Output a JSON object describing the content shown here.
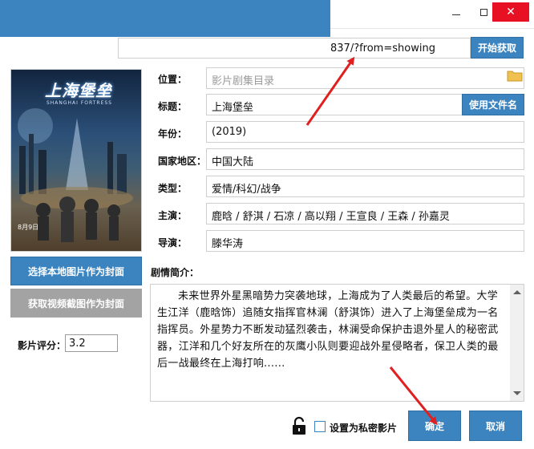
{
  "window": {
    "close_label": "✕"
  },
  "url": {
    "value": "837/?from=showing",
    "fetch_label": "开始获取"
  },
  "poster": {
    "title": "上海堡垒",
    "subtitle": "SHANGHAI FORTRESS",
    "date": "8月9日"
  },
  "cover": {
    "local_label": "选择本地图片作为封面",
    "video_label": "获取视频截图作为封面"
  },
  "rating": {
    "label": "影片评分：",
    "value": "3.2"
  },
  "fields": {
    "location": {
      "label": "位置：",
      "placeholder": "影片剧集目录"
    },
    "title": {
      "label": "标题：",
      "value": "上海堡垒",
      "button": "使用文件名"
    },
    "year": {
      "label": "年份：",
      "value": "(2019)"
    },
    "region": {
      "label": "国家地区：",
      "value": "中国大陆"
    },
    "genre": {
      "label": "类型：",
      "value": "爱情/科幻/战争"
    },
    "cast": {
      "label": "主演：",
      "value": "鹿晗 / 舒淇 / 石凉 / 高以翔 / 王宣良 / 王森 / 孙嘉灵"
    },
    "director": {
      "label": "导演：",
      "value": "滕华涛"
    }
  },
  "synopsis": {
    "label": "剧情简介：",
    "text": "未来世界外星黑暗势力突袭地球，上海成为了人类最后的希望。大学生江洋（鹿晗饰）追随女指挥官林澜（舒淇饰）进入了上海堡垒成为一名指挥员。外星势力不断发动猛烈袭击，林澜受命保护击退外星人的秘密武器，江洋和几个好友所在的灰鹰小队则要迎战外星侵略者，保卫人类的最后一战最终在上海打响......"
  },
  "footer": {
    "private_label": "设置为私密影片",
    "ok_label": "确定",
    "cancel_label": "取消"
  },
  "colors": {
    "accent": "#3c84c0",
    "annotation": "#e02020"
  }
}
